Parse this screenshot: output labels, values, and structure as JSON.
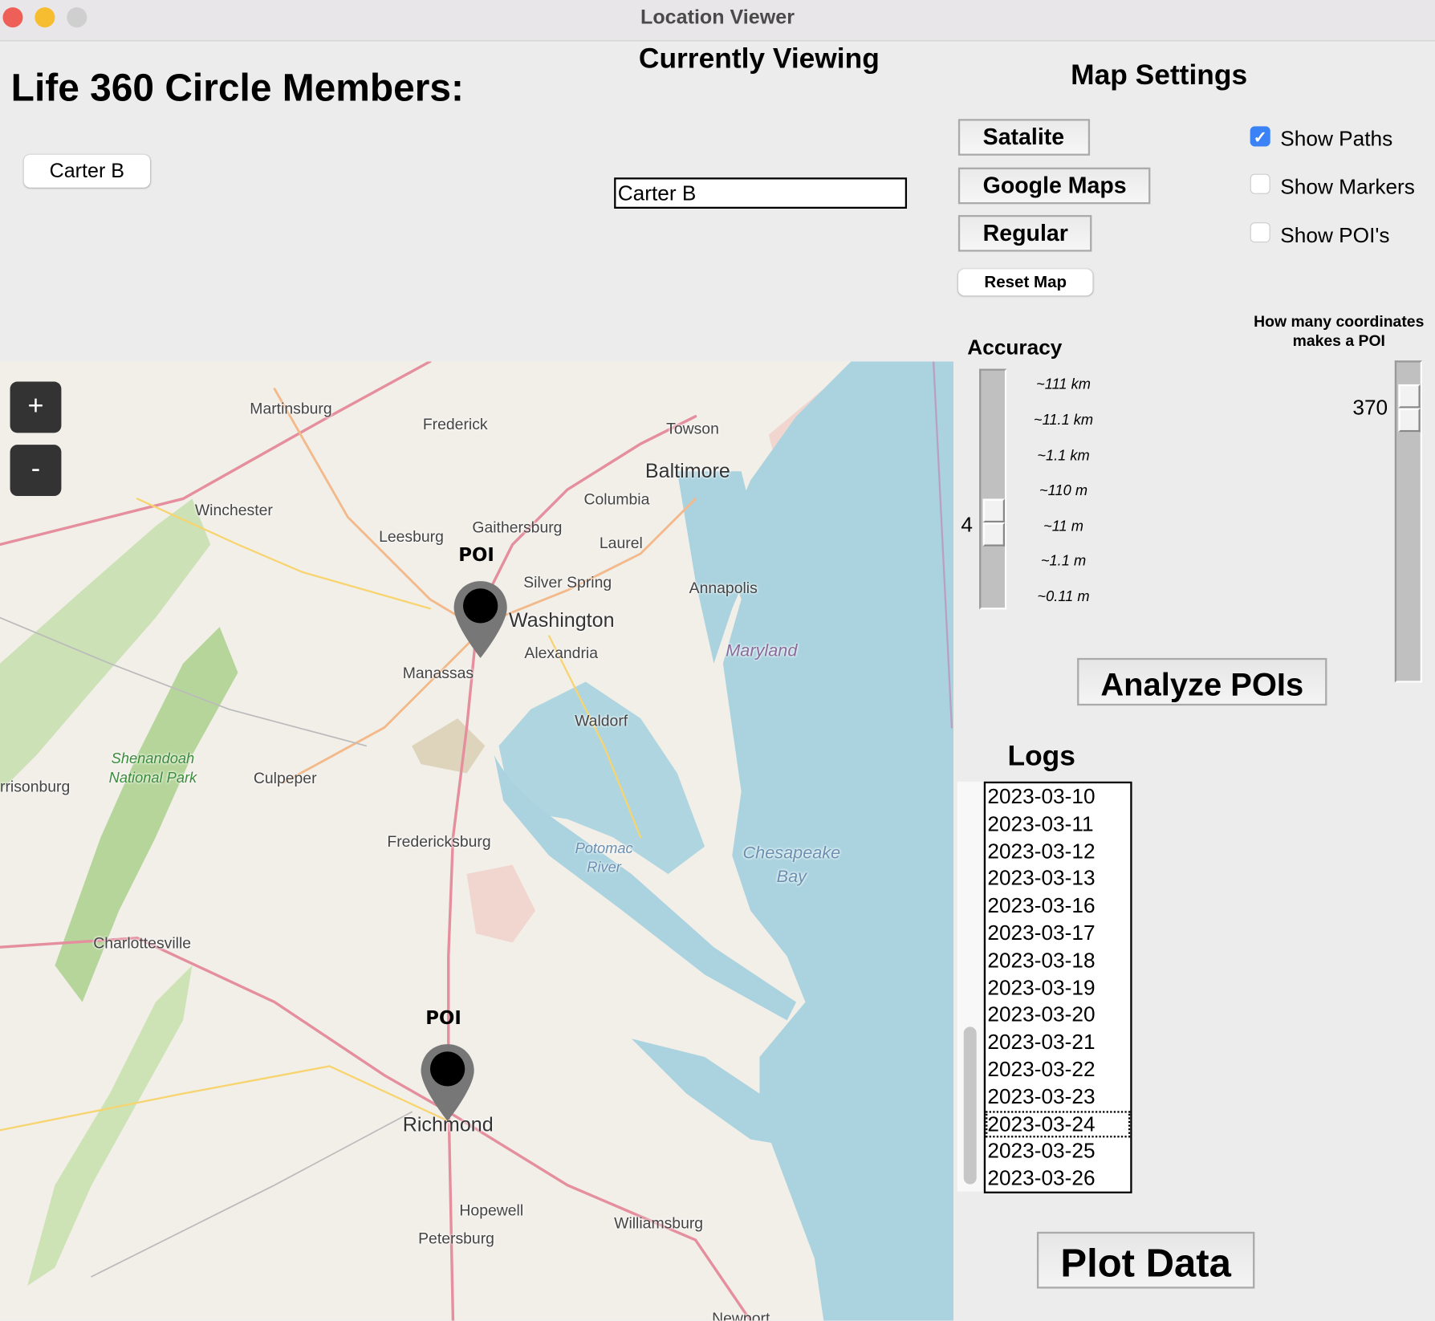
{
  "window": {
    "title": "Location Viewer",
    "controls": {
      "close": "#ee5f57",
      "minimize": "#f5bd2f",
      "zoom": "#cfcfcf"
    }
  },
  "members": {
    "heading": "Life 360 Circle Members:",
    "items": [
      "Carter B"
    ]
  },
  "viewing": {
    "heading": "Currently Viewing",
    "value": "Carter B"
  },
  "settings": {
    "heading": "Map Settings",
    "buttons": [
      "Satalite",
      "Google Maps",
      "Regular"
    ],
    "reset": "Reset Map",
    "checkboxes": [
      {
        "label": "Show Paths",
        "checked": true
      },
      {
        "label": "Show Markers",
        "checked": false
      },
      {
        "label": "Show POI's",
        "checked": false
      }
    ],
    "accent": "#3b82f6"
  },
  "accuracy": {
    "heading": "Accuracy",
    "value": "4",
    "ticks": [
      "~111 km",
      "~11.1 km",
      "~1.1 km",
      "~110 m",
      "~11 m",
      "~1.1 m",
      "~0.11 m"
    ]
  },
  "poi_threshold": {
    "heading_line1": "How many coordinates",
    "heading_line2": "makes a POI",
    "value": "370"
  },
  "analyze": {
    "label": "Analyze POIs"
  },
  "logs": {
    "heading": "Logs",
    "items": [
      "2023-03-10",
      "2023-03-11",
      "2023-03-12",
      "2023-03-13",
      "2023-03-16",
      "2023-03-17",
      "2023-03-18",
      "2023-03-19",
      "2023-03-20",
      "2023-03-21",
      "2023-03-22",
      "2023-03-23",
      "2023-03-24",
      "2023-03-25",
      "2023-03-26"
    ],
    "focused": "2023-03-24"
  },
  "plot": {
    "label": "Plot Data"
  },
  "map": {
    "zoom_in": "+",
    "zoom_out": "-",
    "poi_label": "POI",
    "labels": [
      "Martinsburg",
      "Frederick",
      "Towson",
      "Baltimore",
      "Columbia",
      "Winchester",
      "Leesburg",
      "Gaithersburg",
      "Laurel",
      "Silver Spring",
      "Annapolis",
      "Washington",
      "Alexandria",
      "Manassas",
      "Maryland",
      "Waldorf",
      "Shenandoah National Park",
      "rrisonburg",
      "Culpeper",
      "Fredericksburg",
      "Potomac River",
      "Chesapeake Bay",
      "Charlottesville",
      "Richmond",
      "Hopewell",
      "Petersburg",
      "Williamsburg",
      "Newport"
    ]
  }
}
